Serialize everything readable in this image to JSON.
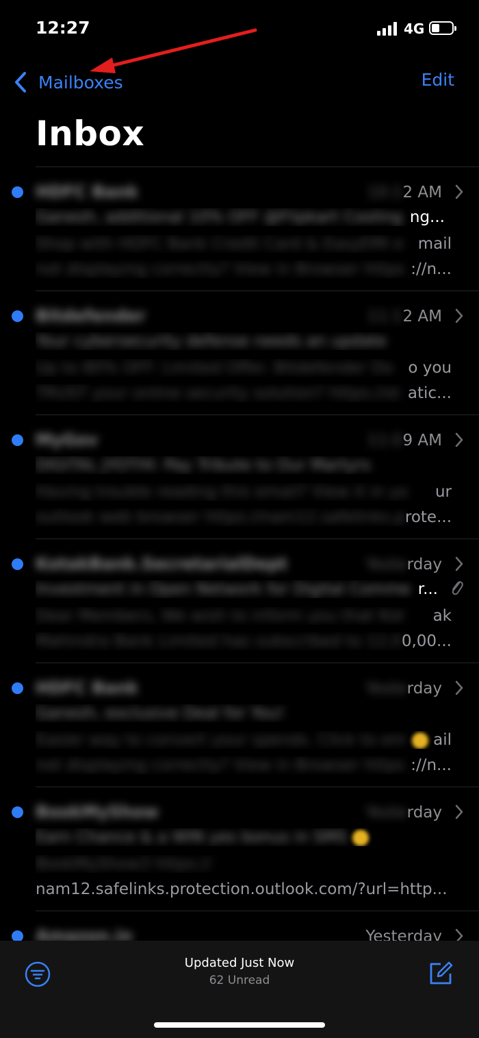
{
  "status_bar": {
    "time": "12:27",
    "network": "4G"
  },
  "nav": {
    "back_label": "Mailboxes",
    "edit_label": "Edit"
  },
  "title": "Inbox",
  "messages": [
    {
      "sender": "HDFC Bank",
      "time_hidden": "10:1",
      "time_visible": "2 AM",
      "subject_hidden": "Ganesh, additional 10% OFF @Flipkart Cooling",
      "subject_visible": "ng...",
      "preview1_hidden": "Shop with HDFC Bank Credit Card & EasyEMI e",
      "preview1_visible": "mail",
      "preview2_hidden": "not displaying correctly? View in Browser https",
      "preview2_visible": "://n...",
      "unread": true
    },
    {
      "sender": "Bitdefender",
      "time_hidden": "11:1",
      "time_visible": "2 AM",
      "subject_hidden": "Your cybersecurity defense needs an update",
      "subject_visible": "",
      "preview1_hidden": "Up to 80% OFF: Limited Offer. Bitdefender Do",
      "preview1_visible": "o you",
      "preview2_hidden": "TRUST your online security solution? https://st",
      "preview2_visible": "atic...",
      "unread": true
    },
    {
      "sender": "MyGov",
      "time_hidden": "11:0",
      "time_visible": "9 AM",
      "subject_hidden": "DIGITAL JYOTHI: Pay Tribute to Our Martyrs",
      "subject_visible": "",
      "preview1_hidden": "Having trouble reading this email? View it in yo",
      "preview1_visible": "ur",
      "preview2_hidden": "outlook web browser https://nam12.safelinks.p",
      "preview2_visible": "rote...",
      "unread": true
    },
    {
      "sender": "KotakBank.SecretarialDept",
      "time_hidden": "Yeste",
      "time_visible": "rday",
      "subject_hidden": "Investment in Open Network for Digital Comme",
      "subject_visible": "r...",
      "preview1_hidden": "Dear Members, We wish to inform you that Kot",
      "preview1_visible": "ak",
      "preview2_hidden": "Mahindra Bank Limited has subscribed to 12,0",
      "preview2_visible": "0,00...",
      "unread": true,
      "attachment": true
    },
    {
      "sender": "HDFC Bank",
      "time_hidden": "Yeste",
      "time_visible": "rday",
      "subject_hidden": "Ganesh, exclusive Deal for You!",
      "subject_visible": "",
      "preview1_hidden": "Easier way to convert your spends. Click to em",
      "preview1_visible": "ail",
      "preview2_hidden": "not displaying correctly? View in Browser https",
      "preview2_visible": "://n...",
      "unread": true
    },
    {
      "sender": "BookMyShow",
      "time_hidden": "Yeste",
      "time_visible": "rday",
      "subject_hidden": "Earn Chance & a WIN yes bonus in SMS",
      "subject_visible": "",
      "preview1_hidden": "BookMyShow3 https://",
      "preview1_visible": "",
      "preview2_hidden": "",
      "preview2_visible": "nam12.safelinks.protection.outlook.com/?url=http...",
      "unread": true
    },
    {
      "sender": "Amazon.in",
      "time_hidden": "",
      "time_visible": "Yesterday",
      "subject_hidden": "",
      "subject_visible": "",
      "preview1_hidden": "",
      "preview1_visible": "",
      "preview2_hidden": "",
      "preview2_visible": "",
      "unread": true
    }
  ],
  "toolbar": {
    "status": "Updated Just Now",
    "unread": "62 Unread"
  },
  "colors": {
    "accent": "#3a82f7",
    "annotation": "#e31e1e",
    "background": "#000000"
  }
}
